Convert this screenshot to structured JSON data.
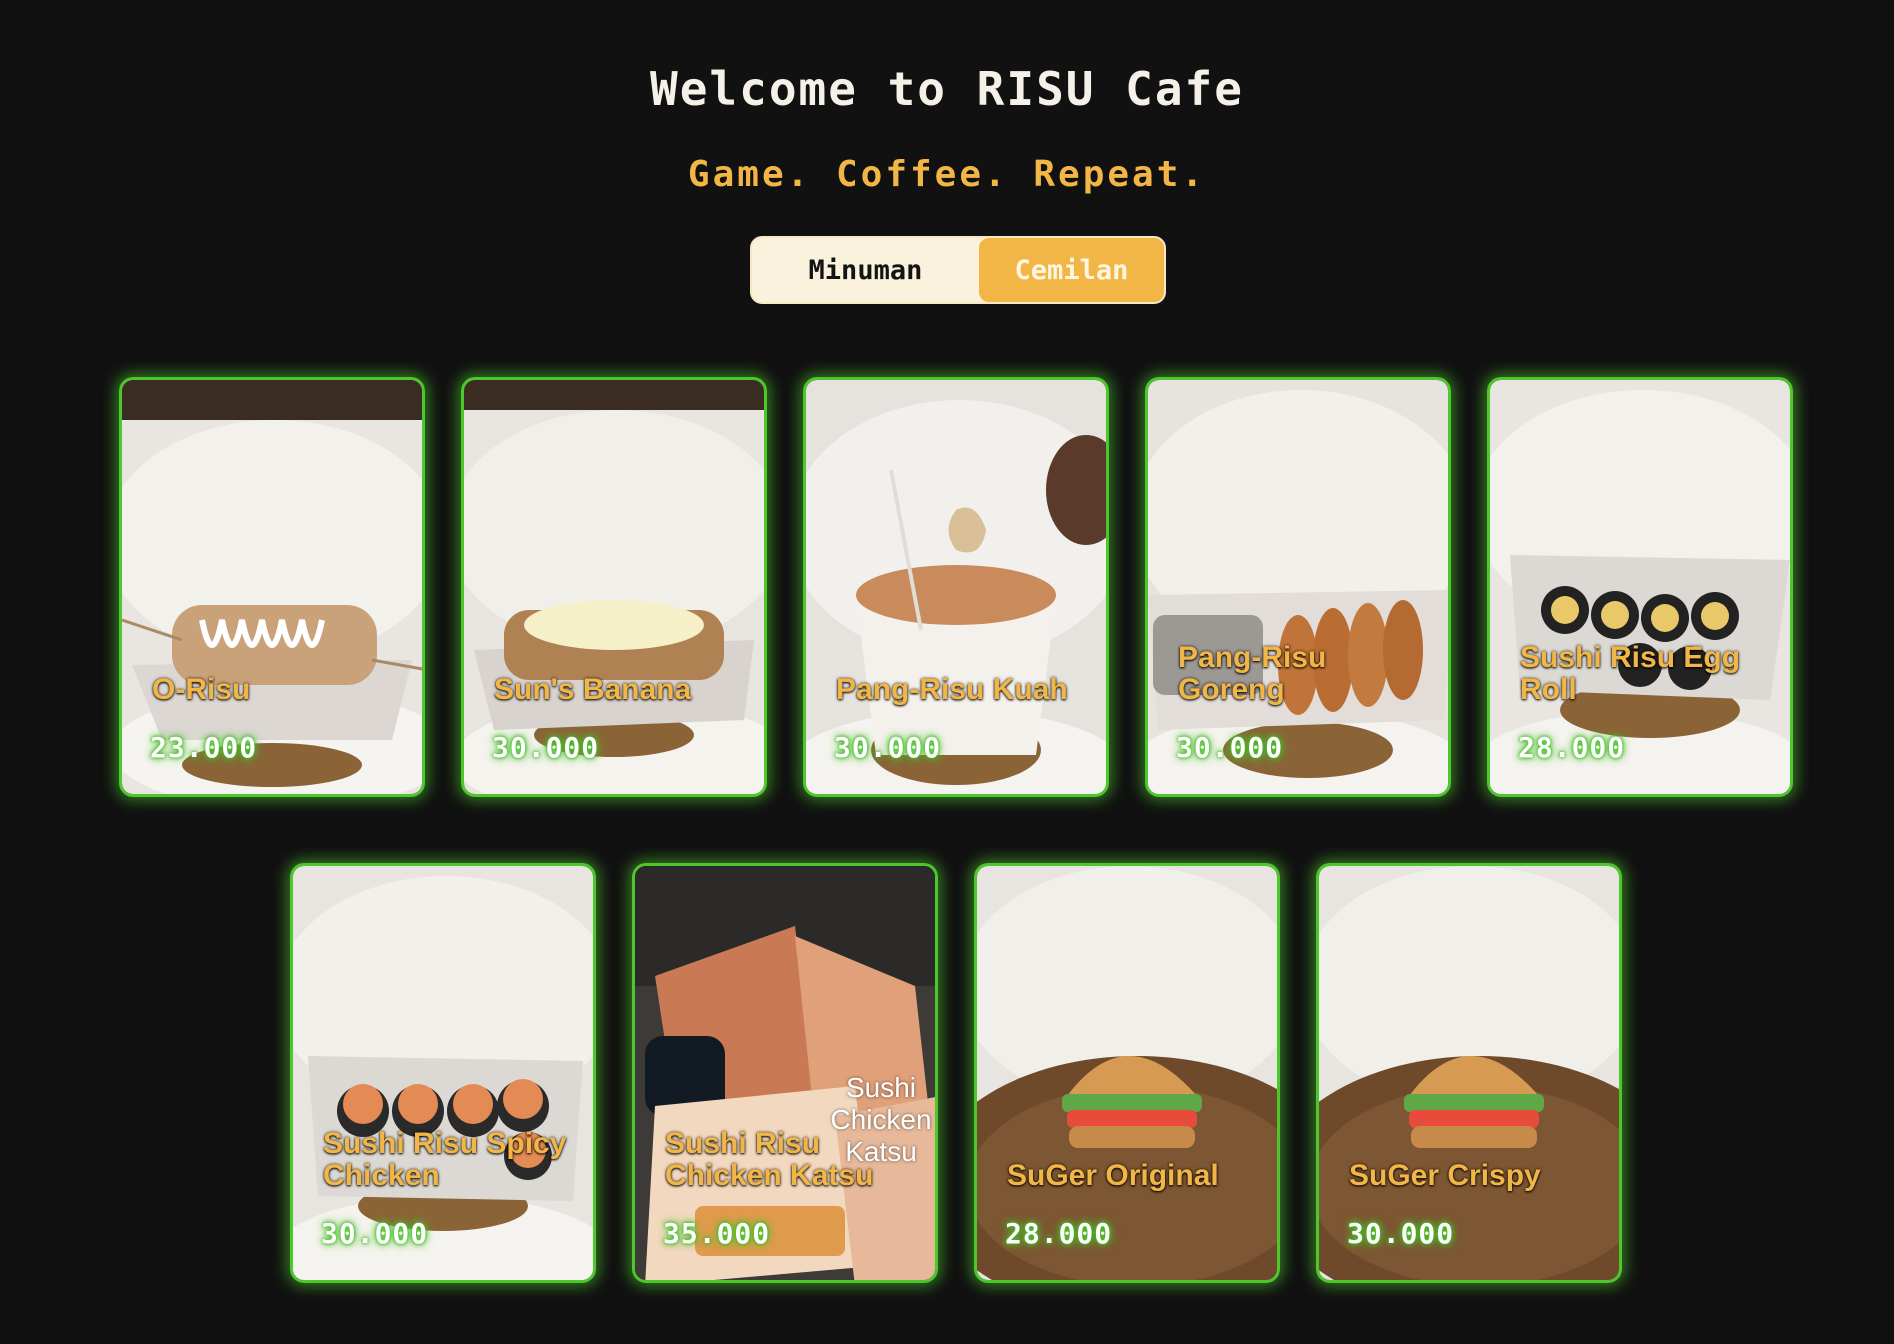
{
  "header": {
    "title": "Welcome to RISU Cafe",
    "tagline": "Game. Coffee. Repeat."
  },
  "tabs": [
    {
      "label": "Minuman",
      "active": false
    },
    {
      "label": "Cemilan",
      "active": true
    }
  ],
  "colors": {
    "background": "#111111",
    "accent_yellow": "#f2b646",
    "card_glow_green": "#4cc72c",
    "toggle_bg": "#fbf2de"
  },
  "menu_items": [
    {
      "name": "O-Risu",
      "price": "23.000"
    },
    {
      "name": "Sun's Banana",
      "price": "30.000"
    },
    {
      "name": "Pang-Risu Kuah",
      "price": "30.000"
    },
    {
      "name": "Pang-Risu Goreng",
      "price": "30.000"
    },
    {
      "name": "Sushi Risu Egg Roll",
      "price": "28.000"
    },
    {
      "name": "Sushi Risu Spicy Chicken",
      "price": "30.000"
    },
    {
      "name": "Sushi Risu Chicken Katsu",
      "price": "35.000",
      "photo_caption": "Sushi Chicken Katsu"
    },
    {
      "name": "SuGer Original",
      "price": "28.000"
    },
    {
      "name": "SuGer Crispy",
      "price": "30.000"
    }
  ]
}
